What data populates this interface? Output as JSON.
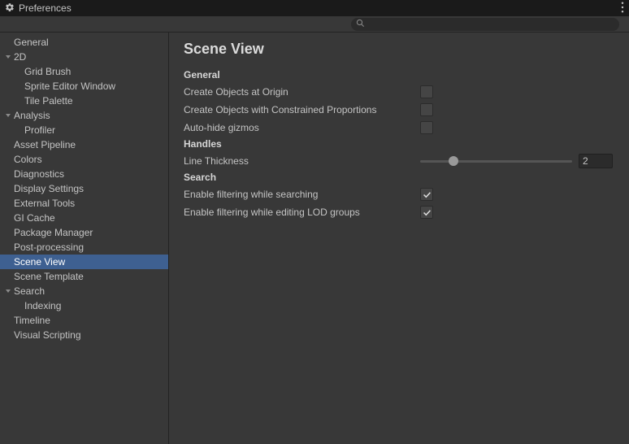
{
  "window": {
    "title": "Preferences"
  },
  "search": {
    "placeholder": ""
  },
  "sidebar": {
    "items": [
      {
        "label": "General",
        "depth": 1,
        "hasFoldout": false,
        "expanded": false,
        "selected": false
      },
      {
        "label": "2D",
        "depth": 1,
        "hasFoldout": true,
        "expanded": true,
        "selected": false
      },
      {
        "label": "Grid Brush",
        "depth": 2,
        "hasFoldout": false,
        "expanded": false,
        "selected": false
      },
      {
        "label": "Sprite Editor Window",
        "depth": 2,
        "hasFoldout": false,
        "expanded": false,
        "selected": false
      },
      {
        "label": "Tile Palette",
        "depth": 2,
        "hasFoldout": false,
        "expanded": false,
        "selected": false
      },
      {
        "label": "Analysis",
        "depth": 1,
        "hasFoldout": true,
        "expanded": true,
        "selected": false
      },
      {
        "label": "Profiler",
        "depth": 2,
        "hasFoldout": false,
        "expanded": false,
        "selected": false
      },
      {
        "label": "Asset Pipeline",
        "depth": 1,
        "hasFoldout": false,
        "expanded": false,
        "selected": false
      },
      {
        "label": "Colors",
        "depth": 1,
        "hasFoldout": false,
        "expanded": false,
        "selected": false
      },
      {
        "label": "Diagnostics",
        "depth": 1,
        "hasFoldout": false,
        "expanded": false,
        "selected": false
      },
      {
        "label": "Display Settings",
        "depth": 1,
        "hasFoldout": false,
        "expanded": false,
        "selected": false
      },
      {
        "label": "External Tools",
        "depth": 1,
        "hasFoldout": false,
        "expanded": false,
        "selected": false
      },
      {
        "label": "GI Cache",
        "depth": 1,
        "hasFoldout": false,
        "expanded": false,
        "selected": false
      },
      {
        "label": "Package Manager",
        "depth": 1,
        "hasFoldout": false,
        "expanded": false,
        "selected": false
      },
      {
        "label": "Post-processing",
        "depth": 1,
        "hasFoldout": false,
        "expanded": false,
        "selected": false
      },
      {
        "label": "Scene View",
        "depth": 1,
        "hasFoldout": false,
        "expanded": false,
        "selected": true
      },
      {
        "label": "Scene Template",
        "depth": 1,
        "hasFoldout": false,
        "expanded": false,
        "selected": false
      },
      {
        "label": "Search",
        "depth": 1,
        "hasFoldout": true,
        "expanded": true,
        "selected": false
      },
      {
        "label": "Indexing",
        "depth": 2,
        "hasFoldout": false,
        "expanded": false,
        "selected": false
      },
      {
        "label": "Timeline",
        "depth": 1,
        "hasFoldout": false,
        "expanded": false,
        "selected": false
      },
      {
        "label": "Visual Scripting",
        "depth": 1,
        "hasFoldout": false,
        "expanded": false,
        "selected": false
      }
    ]
  },
  "content": {
    "title": "Scene View",
    "sections": {
      "general": {
        "header": "General",
        "createAtOrigin": {
          "label": "Create Objects at Origin",
          "checked": false
        },
        "constrainedProps": {
          "label": "Create Objects with Constrained Proportions",
          "checked": false
        },
        "autoHideGizmos": {
          "label": "Auto-hide gizmos",
          "checked": false
        }
      },
      "handles": {
        "header": "Handles",
        "lineThickness": {
          "label": "Line Thickness",
          "value": "2",
          "min": 0,
          "max": 10,
          "percent": 22
        }
      },
      "search": {
        "header": "Search",
        "filterWhileSearching": {
          "label": "Enable filtering while searching",
          "checked": true
        },
        "filterWhileEditingLOD": {
          "label": "Enable filtering while editing LOD groups",
          "checked": true
        }
      }
    }
  },
  "colors": {
    "accent": "#3e6091"
  }
}
